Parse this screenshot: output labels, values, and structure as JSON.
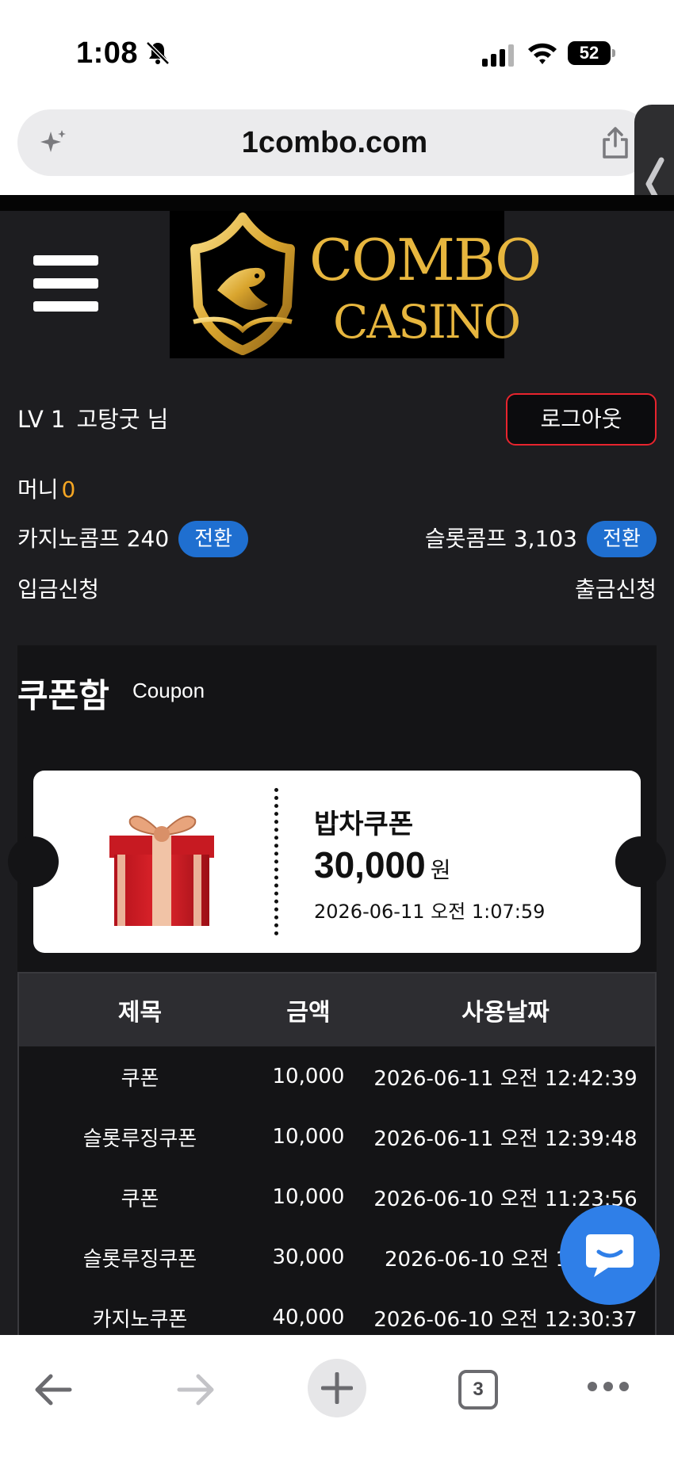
{
  "status_bar": {
    "time": "1:08",
    "battery": "52"
  },
  "browser": {
    "url": "1combo.com",
    "tab_count": "3"
  },
  "site": {
    "logo_line1": "COMBO",
    "logo_line2": "CASINO"
  },
  "user": {
    "level": "LV 1",
    "nickname": "고탕굿 님",
    "logout_label": "로그아웃",
    "money_label": "머니",
    "money_value": "0",
    "casino_comp_label": "카지노콤프 240",
    "slot_comp_label": "슬롯콤프 3,103",
    "convert_label": "전환",
    "deposit_label": "입금신청",
    "withdraw_label": "출금신청"
  },
  "coupon": {
    "title": "쿠폰함",
    "subtitle": "Coupon",
    "ticket": {
      "name": "밥차쿠폰",
      "amount": "30,000",
      "unit": "원",
      "date": "2026-06-11 오전 1:07:59"
    },
    "table": {
      "headers": [
        "제목",
        "금액",
        "사용날짜"
      ],
      "rows": [
        {
          "title": "쿠폰",
          "amount": "10,000",
          "date": "2026-06-11 오전 12:42:39"
        },
        {
          "title": "슬롯루징쿠폰",
          "amount": "10,000",
          "date": "2026-06-11 오전 12:39:48"
        },
        {
          "title": "쿠폰",
          "amount": "10,000",
          "date": "2026-06-10 오전 11:23:56"
        },
        {
          "title": "슬롯루징쿠폰",
          "amount": "30,000",
          "date": "2026-06-10 오전 12:"
        },
        {
          "title": "카지노쿠폰",
          "amount": "40,000",
          "date": "2026-06-10 오전 12:30:37"
        }
      ]
    }
  },
  "colors": {
    "accent_blue": "#1f6fd0",
    "money_orange": "#f5a623",
    "logout_red": "#e8242e",
    "logo_gold": "#e7b63e",
    "chat_blue": "#2f7fe8"
  },
  "icons": [
    "bell-slash-icon",
    "signal-icon",
    "wifi-icon",
    "battery-icon",
    "sparkle-icon",
    "share-icon",
    "chevron-left-icon",
    "menu-icon",
    "shield-logo-icon",
    "gift-icon",
    "chat-icon",
    "back-icon",
    "forward-icon",
    "plus-icon",
    "more-icon"
  ]
}
